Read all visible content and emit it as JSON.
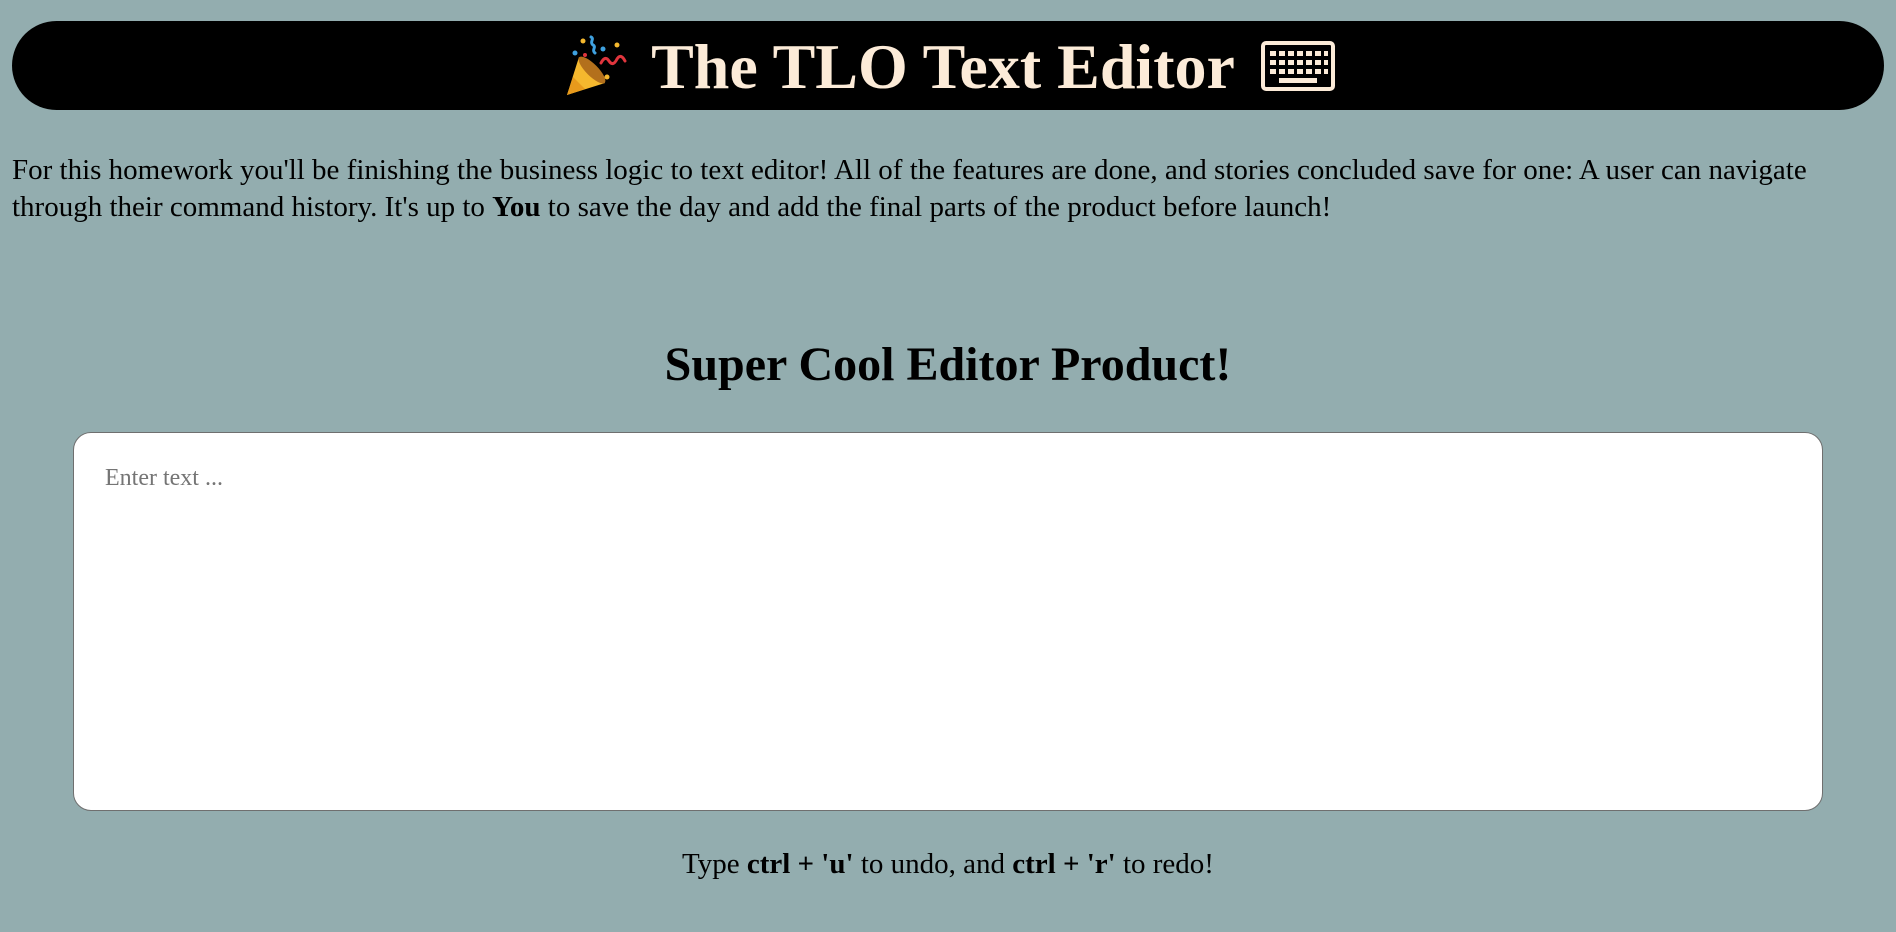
{
  "header": {
    "title": "The TLO Text Editor",
    "left_icon": "party-popper-icon",
    "right_icon": "keyboard-icon",
    "background": "#000000",
    "title_color": "#fcebd8"
  },
  "intro": {
    "part1": "For this homework you'll be finishing the business logic to text editor! All of the features are done, and stories concluded save for one: A user can navigate through their command history. It's up to ",
    "emphasis": "You",
    "part2": " to save the day and add the final parts of the product before launch!"
  },
  "editor_section": {
    "title": "Super Cool Editor Product!",
    "textarea": {
      "value": "",
      "placeholder": "Enter text ..."
    }
  },
  "hint": {
    "prefix": "Type ",
    "undo_keys": "ctrl + 'u'",
    "middle": " to undo, and ",
    "redo_keys": "ctrl + 'r'",
    "suffix": " to redo!"
  },
  "colors": {
    "page_background": "#93adaf"
  }
}
